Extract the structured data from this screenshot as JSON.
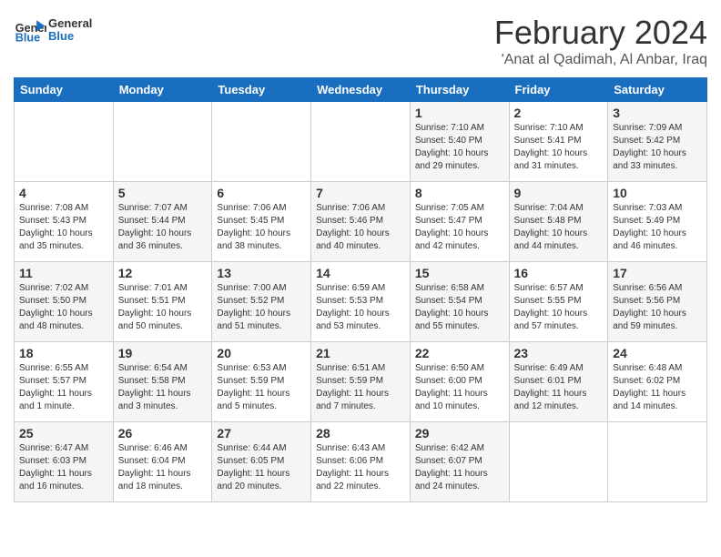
{
  "header": {
    "logo_general": "General",
    "logo_blue": "Blue",
    "month": "February 2024",
    "location": "'Anat al Qadimah, Al Anbar, Iraq"
  },
  "weekdays": [
    "Sunday",
    "Monday",
    "Tuesday",
    "Wednesday",
    "Thursday",
    "Friday",
    "Saturday"
  ],
  "weeks": [
    [
      {
        "day": "",
        "sunrise": "",
        "sunset": "",
        "daylight": ""
      },
      {
        "day": "",
        "sunrise": "",
        "sunset": "",
        "daylight": ""
      },
      {
        "day": "",
        "sunrise": "",
        "sunset": "",
        "daylight": ""
      },
      {
        "day": "",
        "sunrise": "",
        "sunset": "",
        "daylight": ""
      },
      {
        "day": "1",
        "sunrise": "Sunrise: 7:10 AM",
        "sunset": "Sunset: 5:40 PM",
        "daylight": "Daylight: 10 hours and 29 minutes."
      },
      {
        "day": "2",
        "sunrise": "Sunrise: 7:10 AM",
        "sunset": "Sunset: 5:41 PM",
        "daylight": "Daylight: 10 hours and 31 minutes."
      },
      {
        "day": "3",
        "sunrise": "Sunrise: 7:09 AM",
        "sunset": "Sunset: 5:42 PM",
        "daylight": "Daylight: 10 hours and 33 minutes."
      }
    ],
    [
      {
        "day": "4",
        "sunrise": "Sunrise: 7:08 AM",
        "sunset": "Sunset: 5:43 PM",
        "daylight": "Daylight: 10 hours and 35 minutes."
      },
      {
        "day": "5",
        "sunrise": "Sunrise: 7:07 AM",
        "sunset": "Sunset: 5:44 PM",
        "daylight": "Daylight: 10 hours and 36 minutes."
      },
      {
        "day": "6",
        "sunrise": "Sunrise: 7:06 AM",
        "sunset": "Sunset: 5:45 PM",
        "daylight": "Daylight: 10 hours and 38 minutes."
      },
      {
        "day": "7",
        "sunrise": "Sunrise: 7:06 AM",
        "sunset": "Sunset: 5:46 PM",
        "daylight": "Daylight: 10 hours and 40 minutes."
      },
      {
        "day": "8",
        "sunrise": "Sunrise: 7:05 AM",
        "sunset": "Sunset: 5:47 PM",
        "daylight": "Daylight: 10 hours and 42 minutes."
      },
      {
        "day": "9",
        "sunrise": "Sunrise: 7:04 AM",
        "sunset": "Sunset: 5:48 PM",
        "daylight": "Daylight: 10 hours and 44 minutes."
      },
      {
        "day": "10",
        "sunrise": "Sunrise: 7:03 AM",
        "sunset": "Sunset: 5:49 PM",
        "daylight": "Daylight: 10 hours and 46 minutes."
      }
    ],
    [
      {
        "day": "11",
        "sunrise": "Sunrise: 7:02 AM",
        "sunset": "Sunset: 5:50 PM",
        "daylight": "Daylight: 10 hours and 48 minutes."
      },
      {
        "day": "12",
        "sunrise": "Sunrise: 7:01 AM",
        "sunset": "Sunset: 5:51 PM",
        "daylight": "Daylight: 10 hours and 50 minutes."
      },
      {
        "day": "13",
        "sunrise": "Sunrise: 7:00 AM",
        "sunset": "Sunset: 5:52 PM",
        "daylight": "Daylight: 10 hours and 51 minutes."
      },
      {
        "day": "14",
        "sunrise": "Sunrise: 6:59 AM",
        "sunset": "Sunset: 5:53 PM",
        "daylight": "Daylight: 10 hours and 53 minutes."
      },
      {
        "day": "15",
        "sunrise": "Sunrise: 6:58 AM",
        "sunset": "Sunset: 5:54 PM",
        "daylight": "Daylight: 10 hours and 55 minutes."
      },
      {
        "day": "16",
        "sunrise": "Sunrise: 6:57 AM",
        "sunset": "Sunset: 5:55 PM",
        "daylight": "Daylight: 10 hours and 57 minutes."
      },
      {
        "day": "17",
        "sunrise": "Sunrise: 6:56 AM",
        "sunset": "Sunset: 5:56 PM",
        "daylight": "Daylight: 10 hours and 59 minutes."
      }
    ],
    [
      {
        "day": "18",
        "sunrise": "Sunrise: 6:55 AM",
        "sunset": "Sunset: 5:57 PM",
        "daylight": "Daylight: 11 hours and 1 minute."
      },
      {
        "day": "19",
        "sunrise": "Sunrise: 6:54 AM",
        "sunset": "Sunset: 5:58 PM",
        "daylight": "Daylight: 11 hours and 3 minutes."
      },
      {
        "day": "20",
        "sunrise": "Sunrise: 6:53 AM",
        "sunset": "Sunset: 5:59 PM",
        "daylight": "Daylight: 11 hours and 5 minutes."
      },
      {
        "day": "21",
        "sunrise": "Sunrise: 6:51 AM",
        "sunset": "Sunset: 5:59 PM",
        "daylight": "Daylight: 11 hours and 7 minutes."
      },
      {
        "day": "22",
        "sunrise": "Sunrise: 6:50 AM",
        "sunset": "Sunset: 6:00 PM",
        "daylight": "Daylight: 11 hours and 10 minutes."
      },
      {
        "day": "23",
        "sunrise": "Sunrise: 6:49 AM",
        "sunset": "Sunset: 6:01 PM",
        "daylight": "Daylight: 11 hours and 12 minutes."
      },
      {
        "day": "24",
        "sunrise": "Sunrise: 6:48 AM",
        "sunset": "Sunset: 6:02 PM",
        "daylight": "Daylight: 11 hours and 14 minutes."
      }
    ],
    [
      {
        "day": "25",
        "sunrise": "Sunrise: 6:47 AM",
        "sunset": "Sunset: 6:03 PM",
        "daylight": "Daylight: 11 hours and 16 minutes."
      },
      {
        "day": "26",
        "sunrise": "Sunrise: 6:46 AM",
        "sunset": "Sunset: 6:04 PM",
        "daylight": "Daylight: 11 hours and 18 minutes."
      },
      {
        "day": "27",
        "sunrise": "Sunrise: 6:44 AM",
        "sunset": "Sunset: 6:05 PM",
        "daylight": "Daylight: 11 hours and 20 minutes."
      },
      {
        "day": "28",
        "sunrise": "Sunrise: 6:43 AM",
        "sunset": "Sunset: 6:06 PM",
        "daylight": "Daylight: 11 hours and 22 minutes."
      },
      {
        "day": "29",
        "sunrise": "Sunrise: 6:42 AM",
        "sunset": "Sunset: 6:07 PM",
        "daylight": "Daylight: 11 hours and 24 minutes."
      },
      {
        "day": "",
        "sunrise": "",
        "sunset": "",
        "daylight": ""
      },
      {
        "day": "",
        "sunrise": "",
        "sunset": "",
        "daylight": ""
      }
    ]
  ]
}
